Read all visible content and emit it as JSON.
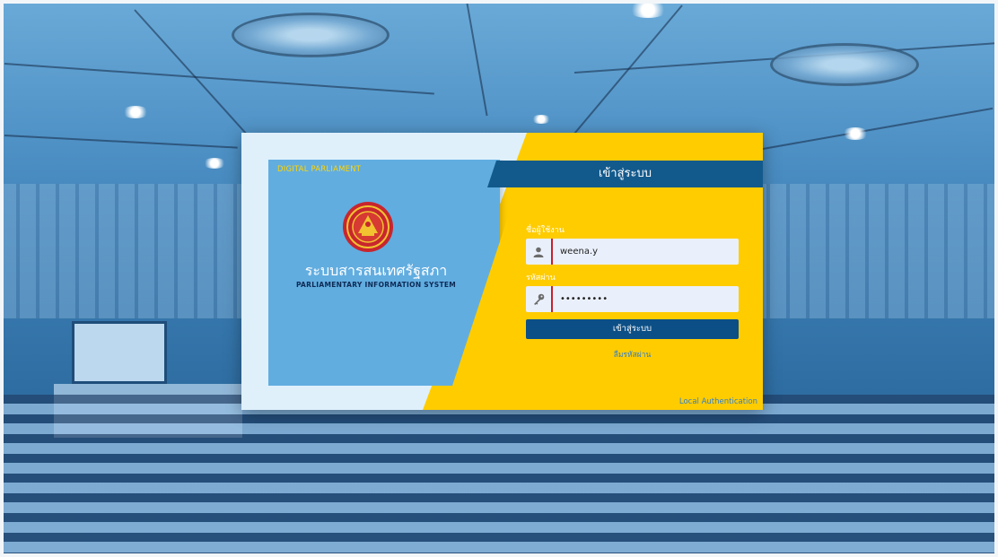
{
  "card": {
    "brand_tag": "DIGITAL PARLIAMENT",
    "system_name_th": "ระบบสารสนเทศรัฐสภา",
    "system_name_en": "PARLIAMENTARY INFORMATION SYSTEM",
    "emblem_icon": "parliament-emblem-icon"
  },
  "login": {
    "title": "เข้าสู่ระบบ",
    "username_label": "ชื่อผู้ใช้งาน",
    "username_value": "weena.y",
    "username_icon": "user-icon",
    "password_label": "รหัสผ่าน",
    "password_value": "•••••••••",
    "password_icon": "key-icon",
    "submit_label": "เข้าสู่ระบบ",
    "forgot_label": "ลืมรหัสผ่าน",
    "auth_mode": "Local Authentication"
  },
  "colors": {
    "accent_yellow": "#ffcc00",
    "panel_blue": "#61ade0",
    "header_navy": "#135a8c",
    "button_navy": "#0c4f86",
    "input_marker_red": "#c7202b"
  }
}
